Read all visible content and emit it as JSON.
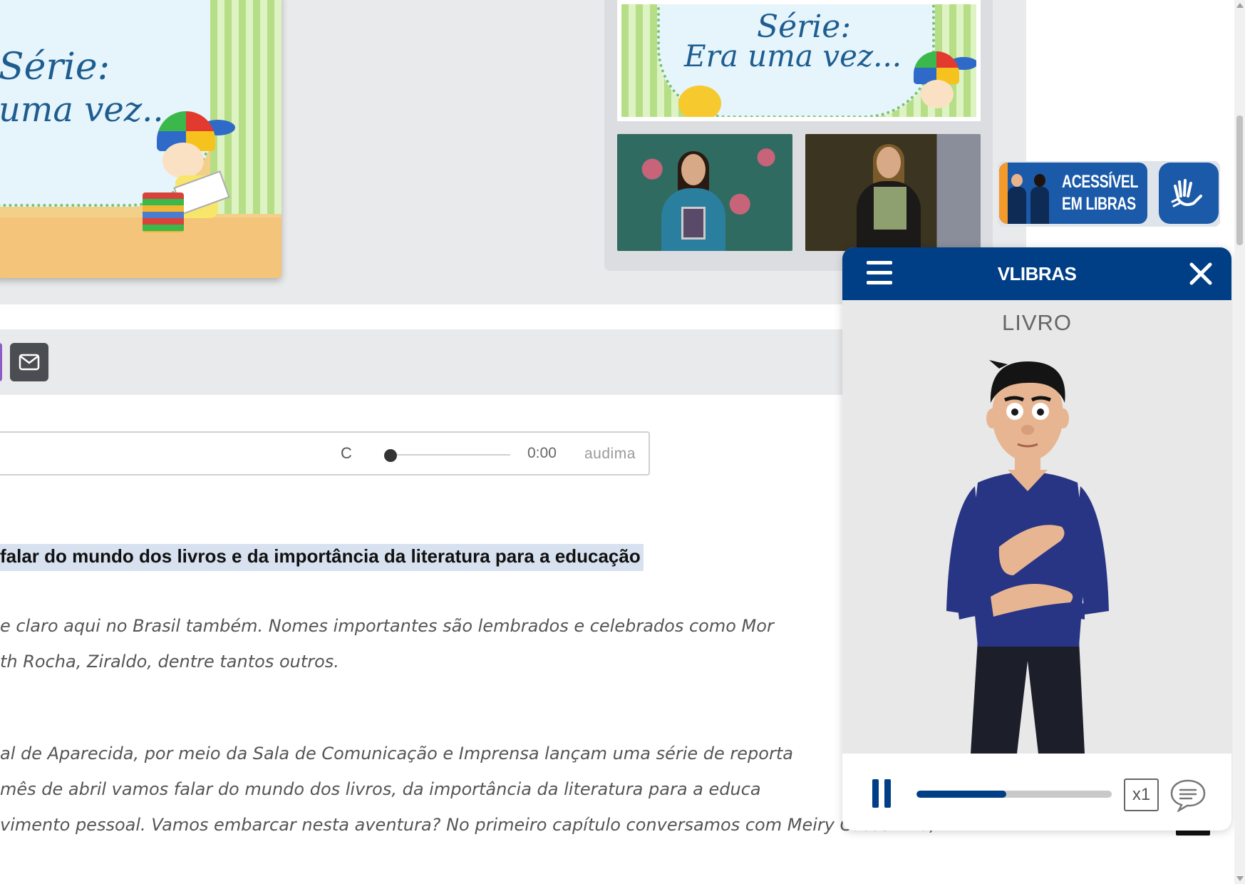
{
  "hero": {
    "main_poster": {
      "line1": "Série:",
      "line2": "uma vez..."
    },
    "gallery_poster": {
      "line1": "Série:",
      "line2": "Era uma vez..."
    }
  },
  "player": {
    "c_label": "C",
    "time": "0:00",
    "brand": "audima",
    "progress_fraction": 0
  },
  "article": {
    "headline": "falar do mundo dos livros e da importância da literatura para a educação",
    "paragraph1": [
      "e claro aqui no Brasil também. Nomes importantes são lembrados e celebrados como Mor",
      "th Rocha, Ziraldo, dentre tantos outros."
    ],
    "paragraph2": [
      "al de Aparecida, por meio da Sala de Comunicação e Imprensa lançam uma série de reporta",
      "mês de abril vamos falar do mundo dos livros, da importância da literatura para a educa",
      "vimento pessoal. Vamos embarcar nesta aventura? No primeiro capítulo conversamos com Meiry Cassemiro,"
    ]
  },
  "libras_badge": {
    "line1": "ACESSÍVEL",
    "line2": "EM LIBRAS",
    "icon": "sign-language-hand-icon"
  },
  "widget": {
    "title": "VLIBRAS",
    "word": "LIVRO",
    "speed": "x1",
    "progress_fraction": 0.46,
    "colors": {
      "primary": "#003f86",
      "background": "#e8e8e8"
    }
  },
  "share": {
    "icons": [
      "share-purple-icon",
      "mail-icon"
    ],
    "colors": {
      "purple": "#8e5bc7",
      "mail_bg": "#4a4d52"
    }
  }
}
